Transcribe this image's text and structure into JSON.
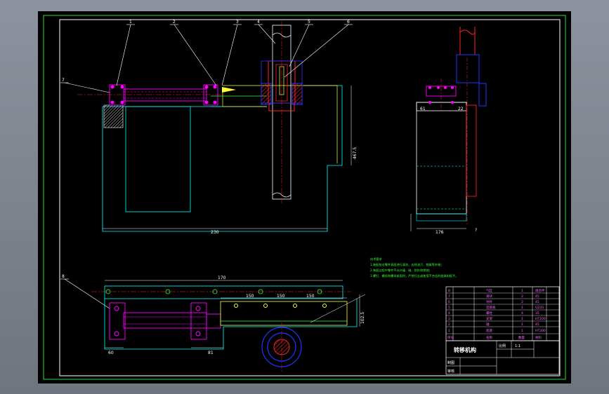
{
  "colors": {
    "background": "#000000",
    "frame": "#33dd33",
    "border": "#ffffff",
    "cyan": "#00ffff",
    "magenta": "#ff00ff",
    "yellow": "#ffff33",
    "blue": "#2233ff",
    "red": "#ff2222",
    "green": "#33ff33"
  },
  "dimensions": {
    "front_width": "230",
    "front_height": "467.5",
    "side_width": "176",
    "side_left": "61",
    "side_right": "22",
    "side_marker": "?",
    "plan_width": "170",
    "plan_spacing": [
      "150",
      "150",
      "150"
    ],
    "plan_left": "60",
    "plan_bottom": "81",
    "plan_height": "102.5"
  },
  "leader_numbers": [
    "1",
    "2",
    "3",
    "4",
    "5",
    "6",
    "7",
    "8"
  ],
  "notes": {
    "title": "技术要求",
    "lines": [
      "1.装配前对零件表面进行清洗，去除油污、铁屑等杂物；",
      "2.装配过程中零件不允许磕、碰、划伤和锈蚀；",
      "3.螺钉、螺栓和螺母紧固时，严禁打击或使用不合适的旋具和扳手。"
    ]
  },
  "title_block": {
    "drawing_title": "转移机构",
    "scale_label": "比例",
    "scale_value": "1:1",
    "designer_label": "制图",
    "checker_label": "审核",
    "header": [
      "序号",
      "名称",
      "数量",
      "材料"
    ],
    "rows": [
      {
        "no": "8",
        "name": "气缸",
        "qty": "1",
        "mat": "组合件"
      },
      {
        "no": "7",
        "name": "滑块",
        "qty": "2",
        "mat": "45"
      },
      {
        "no": "6",
        "name": "导杆",
        "qty": "2",
        "mat": "45"
      },
      {
        "no": "5",
        "name": "连接板",
        "qty": "1",
        "mat": "Q235"
      },
      {
        "no": "4",
        "name": "螺栓",
        "qty": "4",
        "mat": "35"
      },
      {
        "no": "3",
        "name": "支架",
        "qty": "1",
        "mat": "HT200"
      },
      {
        "no": "2",
        "name": "轴",
        "qty": "1",
        "mat": "45"
      },
      {
        "no": "1",
        "name": "底座",
        "qty": "1",
        "mat": "HT200"
      }
    ]
  }
}
